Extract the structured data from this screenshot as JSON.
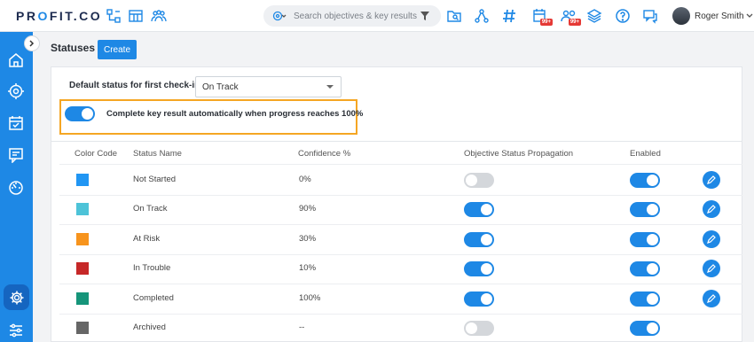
{
  "header": {
    "logo_main": "PR",
    "logo_o": "O",
    "logo_rest": "FIT.CO",
    "search_placeholder": "Search objectives & key results",
    "notifications_a": "99+",
    "notifications_b": "99+",
    "user_name": "Roger Smith"
  },
  "page": {
    "title": "Statuses",
    "create_label": "Create",
    "default_status_label": "Default status for first check-in",
    "default_status_value": "On Track",
    "auto_complete_label": "Complete key result automatically when progress reaches 100%",
    "auto_complete_enabled": true
  },
  "table": {
    "columns": [
      "Color Code",
      "Status Name",
      "Confidence %",
      "Objective Status Propagation",
      "Enabled"
    ],
    "rows": [
      {
        "color": "#2196f3",
        "name": "Not Started",
        "confidence": "0%",
        "propagation": false,
        "enabled": true,
        "editable": true
      },
      {
        "color": "#4dc3d8",
        "name": "On Track",
        "confidence": "90%",
        "propagation": true,
        "enabled": true,
        "editable": true
      },
      {
        "color": "#f7941d",
        "name": "At Risk",
        "confidence": "30%",
        "propagation": true,
        "enabled": true,
        "editable": true
      },
      {
        "color": "#c62828",
        "name": "In Trouble",
        "confidence": "10%",
        "propagation": true,
        "enabled": true,
        "editable": true
      },
      {
        "color": "#16957a",
        "name": "Completed",
        "confidence": "100%",
        "propagation": true,
        "enabled": true,
        "editable": true
      },
      {
        "color": "#666666",
        "name": "Archived",
        "confidence": "--",
        "propagation": false,
        "enabled": true,
        "editable": false
      }
    ]
  },
  "colors": {
    "accent": "#1e88e5",
    "sidebar": "#1e88e5",
    "highlight": "#f5a623"
  }
}
